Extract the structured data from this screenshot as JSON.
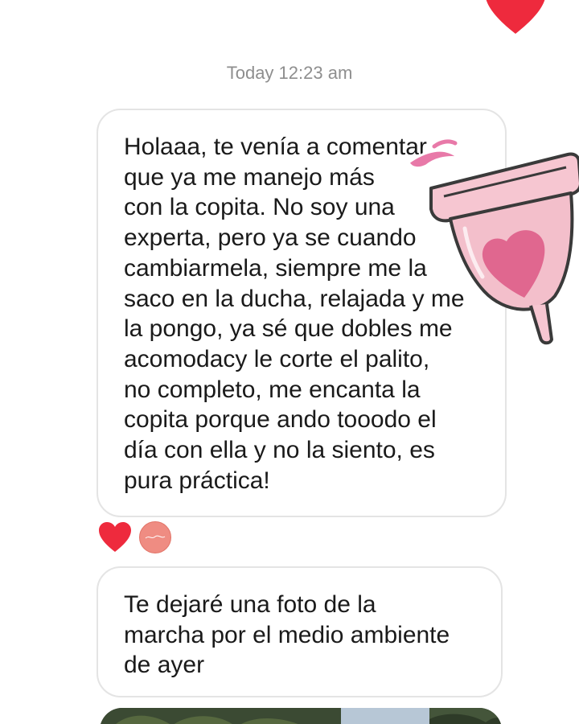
{
  "conversation": {
    "timestamp": "Today 12:23 am",
    "messages": [
      {
        "lines": [
          "Holaaa, te venía a comentar",
          "que ya me manejo más",
          "con la copita. No soy una",
          "experta, pero ya se cuando",
          "cambiarmela, siempre me la",
          "saco en la ducha, relajada y me",
          "la pongo, ya sé que dobles me",
          "acomodacy le corte el palito,",
          "no completo, me encanta la",
          "copita porque ando tooodo el",
          "día con ella y no la siento, es",
          "pura práctica!"
        ]
      },
      {
        "lines": [
          "Te dejaré una foto de la",
          "marcha por el medio ambiente",
          "de ayer"
        ]
      }
    ]
  },
  "icons": {
    "top_reaction": "heart-icon",
    "sticker": "menstrual-cup-sticker",
    "message_reaction": "heart-icon",
    "reactor": "avatar"
  },
  "colors": {
    "heart": "#ee2a3d",
    "bubble_border": "#e4e4e4",
    "timestamp": "#8e8e8e",
    "text": "#1a1a1a",
    "cup_pink": "#f2b5c3",
    "cup_heart": "#e5678f"
  }
}
